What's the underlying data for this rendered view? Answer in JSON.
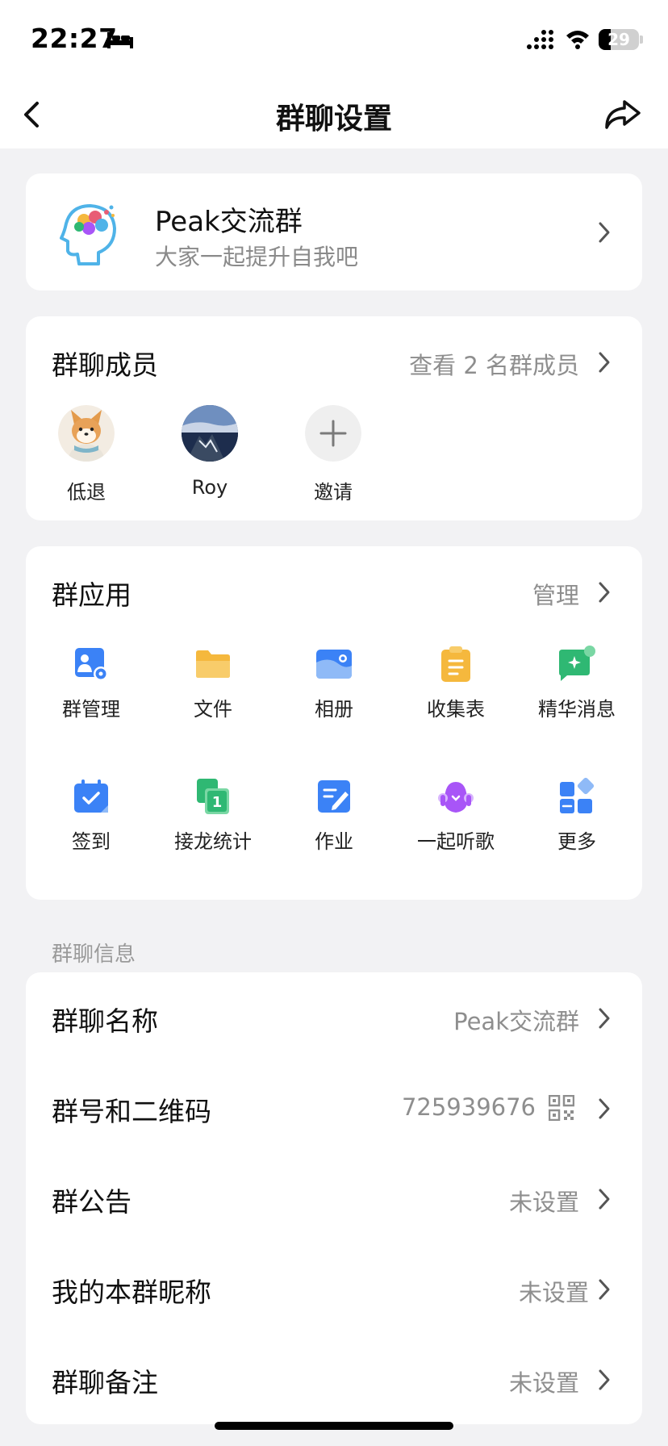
{
  "status_bar": {
    "time": "22:27",
    "battery": "29",
    "battery_level": 0.29
  },
  "nav": {
    "title": "群聊设置"
  },
  "group": {
    "name": "Peak交流群",
    "description": "大家一起提升自我吧"
  },
  "members": {
    "title": "群聊成员",
    "view_all": "查看 2 名群成员",
    "items": [
      {
        "name": "低退",
        "avatar": "shiba-dog-avatar"
      },
      {
        "name": "Roy",
        "avatar": "landscape-avatar"
      },
      {
        "name": "邀请",
        "avatar": "plus-icon"
      }
    ]
  },
  "apps": {
    "title": "群应用",
    "manage": "管理",
    "items": [
      {
        "label": "群管理",
        "icon": "group-manage-icon",
        "color": "#3b82f6"
      },
      {
        "label": "文件",
        "icon": "folder-icon",
        "color": "#f5b83d"
      },
      {
        "label": "相册",
        "icon": "album-icon",
        "color": "#3b82f6"
      },
      {
        "label": "收集表",
        "icon": "clipboard-icon",
        "color": "#f5b83d"
      },
      {
        "label": "精华消息",
        "icon": "essence-message-icon",
        "color": "#2fb873"
      },
      {
        "label": "签到",
        "icon": "calendar-check-icon",
        "color": "#3b82f6"
      },
      {
        "label": "接龙统计",
        "icon": "relay-icon",
        "color": "#2fb873"
      },
      {
        "label": "作业",
        "icon": "homework-icon",
        "color": "#3b82f6"
      },
      {
        "label": "一起听歌",
        "icon": "music-icon",
        "color": "#a855f7"
      },
      {
        "label": "更多",
        "icon": "more-apps-icon",
        "color": "#3b82f6"
      }
    ]
  },
  "info": {
    "section_title": "群聊信息",
    "rows": [
      {
        "label": "群聊名称",
        "value": "Peak交流群"
      },
      {
        "label": "群号和二维码",
        "value": "725939676"
      },
      {
        "label": "群公告",
        "value": "未设置"
      },
      {
        "label": "我的本群昵称",
        "value": "未设置"
      },
      {
        "label": "群聊备注",
        "value": "未设置"
      }
    ]
  }
}
